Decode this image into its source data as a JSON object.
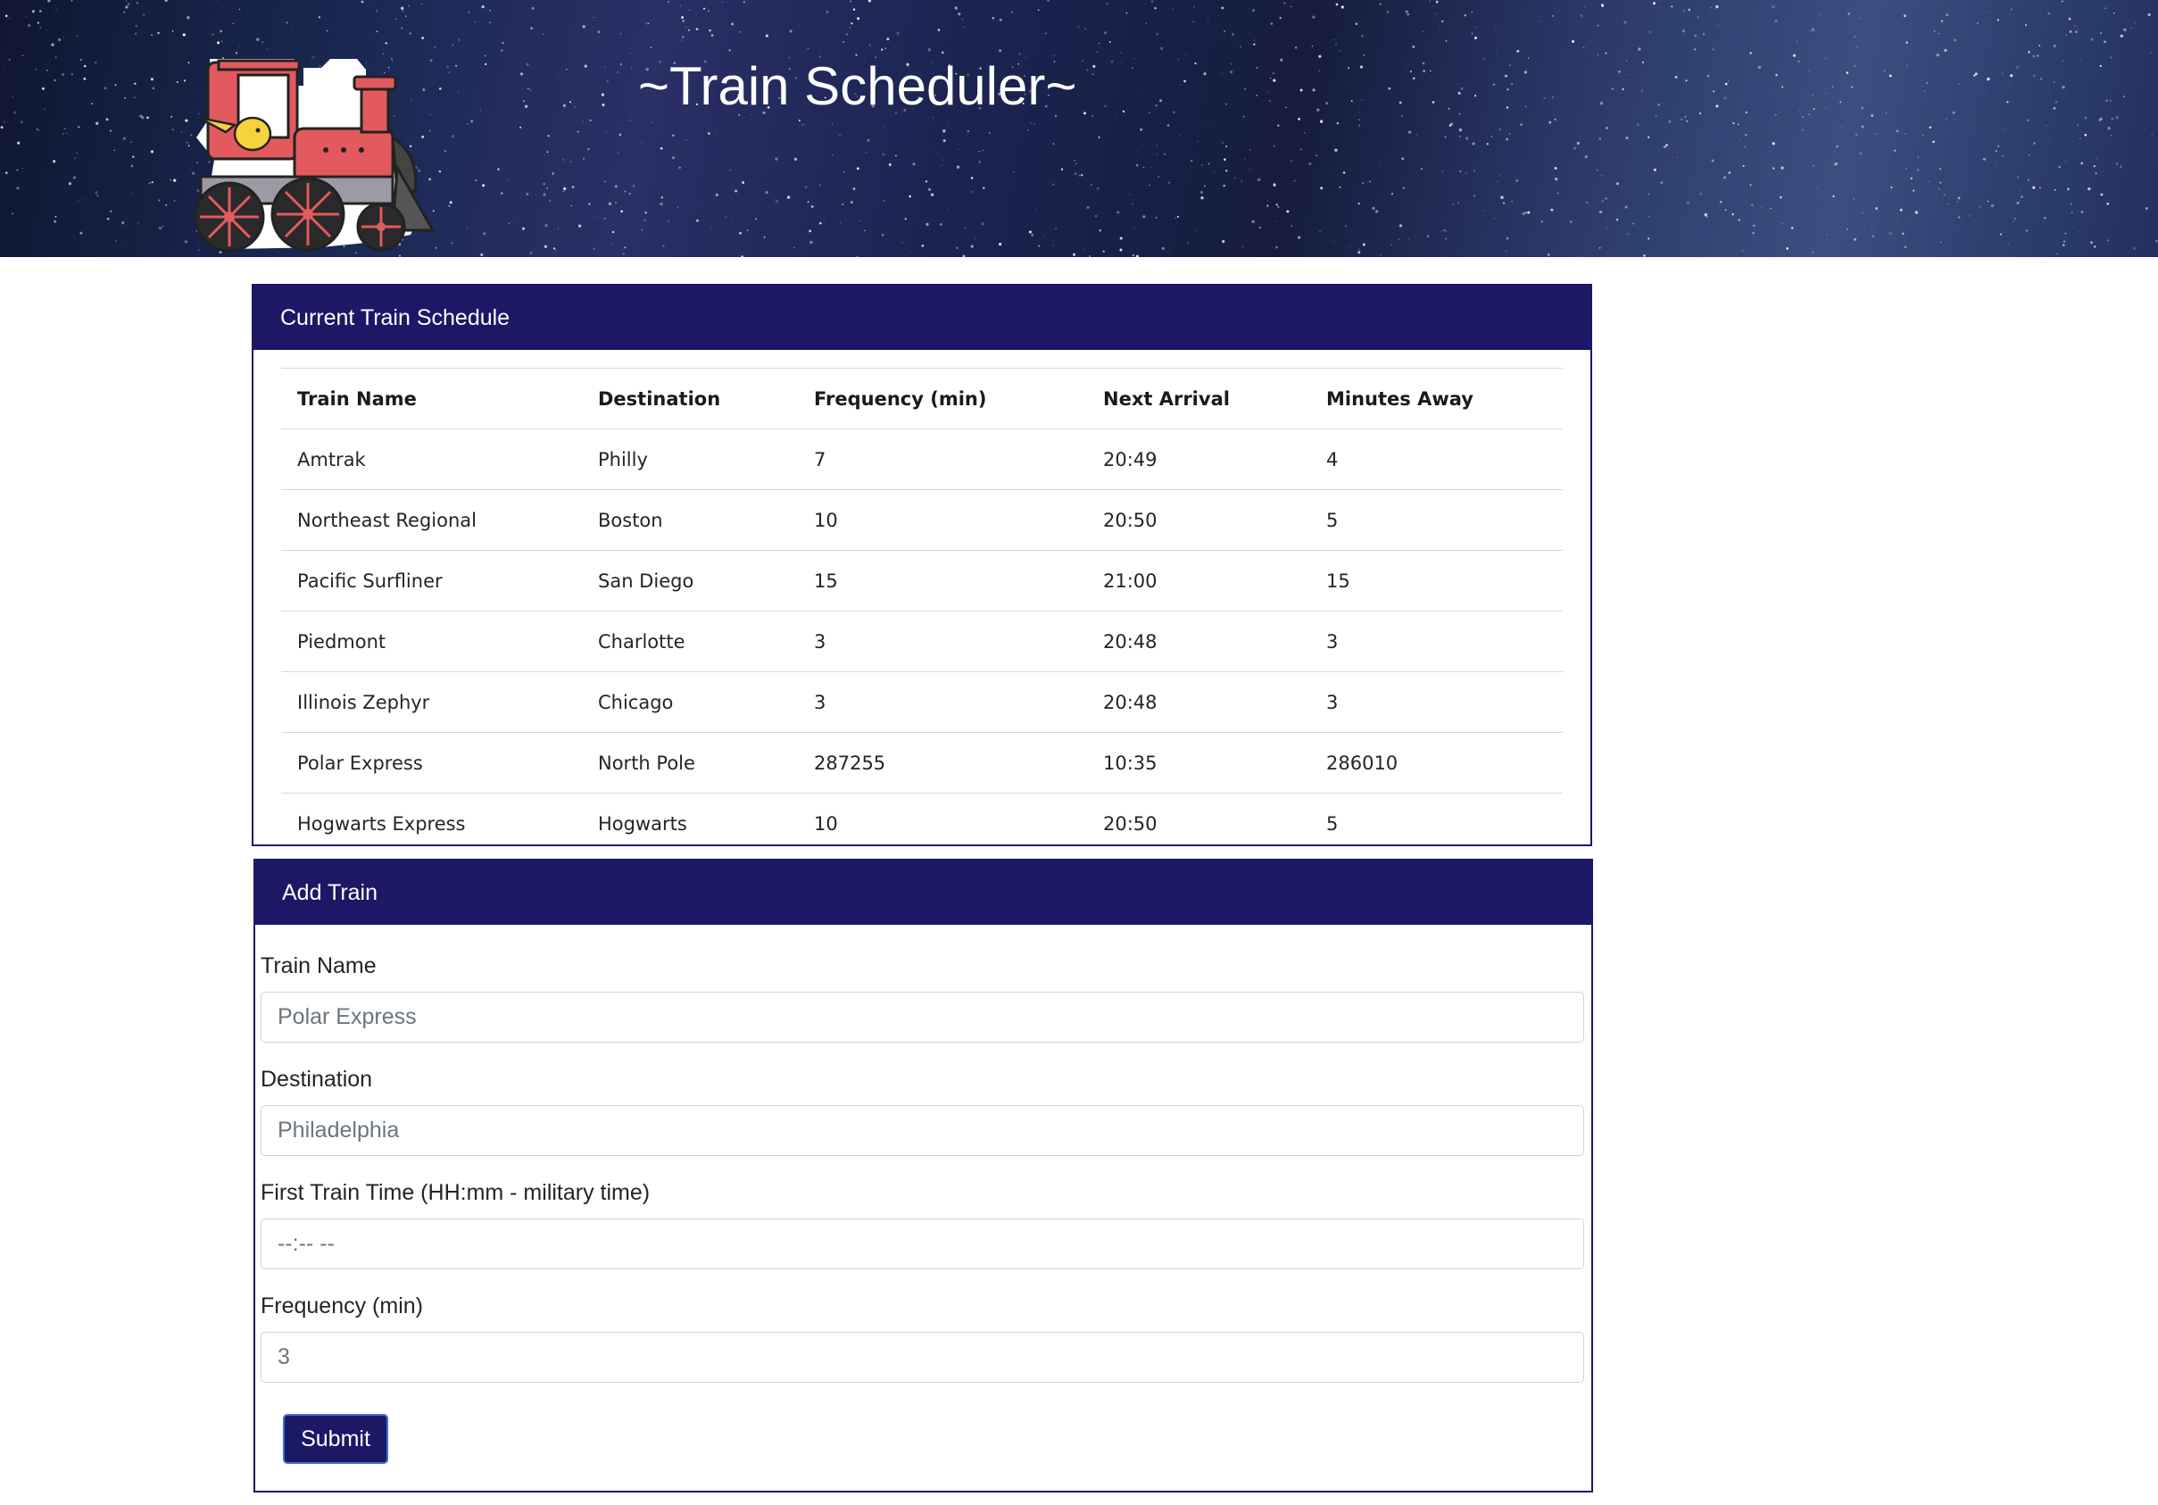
{
  "header": {
    "title": "~Train Scheduler~"
  },
  "schedule": {
    "title": "Current Train Schedule",
    "columns": [
      "Train Name",
      "Destination",
      "Frequency (min)",
      "Next Arrival",
      "Minutes Away"
    ],
    "rows": [
      [
        "Amtrak",
        "Philly",
        "7",
        "20:49",
        "4"
      ],
      [
        "Northeast Regional",
        "Boston",
        "10",
        "20:50",
        "5"
      ],
      [
        "Pacific Surfliner",
        "San Diego",
        "15",
        "21:00",
        "15"
      ],
      [
        "Piedmont",
        "Charlotte",
        "3",
        "20:48",
        "3"
      ],
      [
        "Illinois Zephyr",
        "Chicago",
        "3",
        "20:48",
        "3"
      ],
      [
        "Polar Express",
        "North Pole",
        "287255",
        "10:35",
        "286010"
      ],
      [
        "Hogwarts Express",
        "Hogwarts",
        "10",
        "20:50",
        "5"
      ]
    ]
  },
  "add_train": {
    "title": "Add Train",
    "fields": {
      "train_name": {
        "label": "Train Name",
        "placeholder": "Polar Express"
      },
      "destination": {
        "label": "Destination",
        "placeholder": "Philadelphia"
      },
      "first_time": {
        "label": "First Train Time (HH:mm - military time)",
        "placeholder": "--:-- --"
      },
      "frequency": {
        "label": "Frequency (min)",
        "placeholder": "3"
      }
    },
    "submit_label": "Submit"
  },
  "colors": {
    "panel_header": "#1c1866",
    "banner": "#1b2a55"
  }
}
